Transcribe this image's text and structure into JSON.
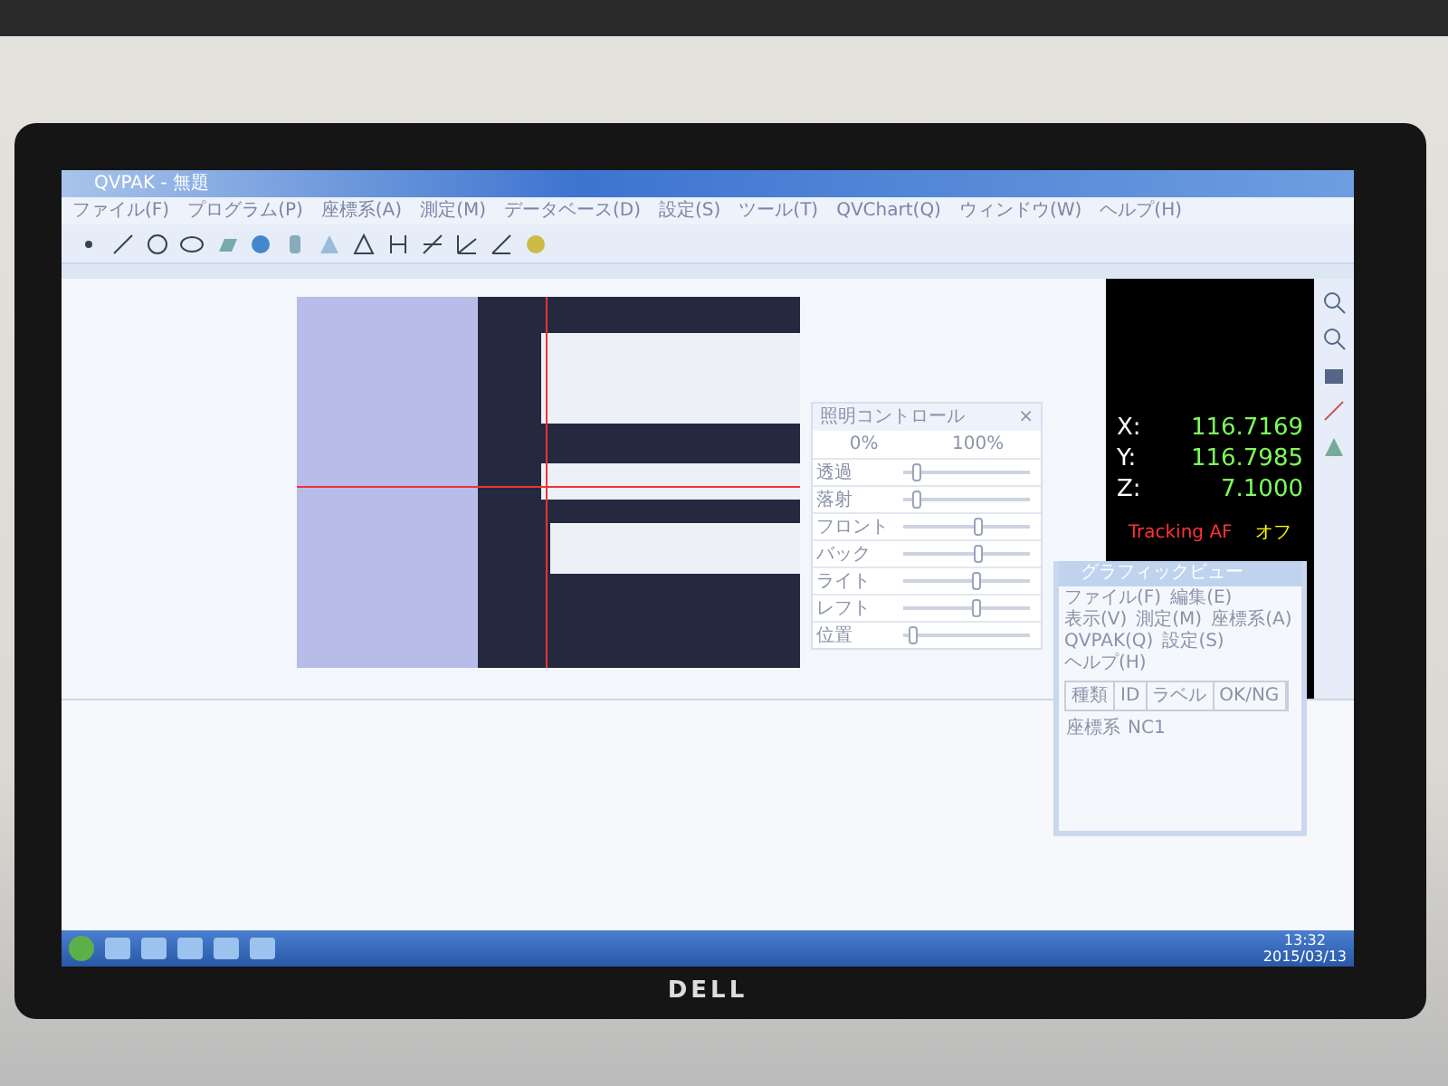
{
  "brand": "DELL",
  "window": {
    "title": "QVPAK - 無題"
  },
  "menu": [
    "ファイル(F)",
    "プログラム(P)",
    "座標系(A)",
    "測定(M)",
    "データベース(D)",
    "設定(S)",
    "ツール(T)",
    "QVChart(Q)",
    "ウィンドウ(W)",
    "ヘルプ(H)"
  ],
  "lighting_panel": {
    "title": "照明コントロール",
    "close": "×",
    "scale_min": "0%",
    "scale_max": "100%",
    "rows": [
      {
        "label": "透過",
        "level": 0.08
      },
      {
        "label": "落射",
        "level": 0.08
      },
      {
        "label": "フロント",
        "level": 0.62
      },
      {
        "label": "バック",
        "level": 0.62
      },
      {
        "label": "ライト",
        "level": 0.6
      },
      {
        "label": "レフト",
        "level": 0.6
      },
      {
        "label": "位置",
        "level": 0.04
      }
    ]
  },
  "dro": {
    "axes": [
      {
        "label": "X:",
        "value": "116.7169"
      },
      {
        "label": "Y:",
        "value": "116.7985"
      },
      {
        "label": "Z:",
        "value": "7.1000"
      }
    ],
    "tracking_label": "Tracking AF",
    "tracking_value": "オフ"
  },
  "graphic_window": {
    "title": "グラフィックビュー",
    "menu": [
      "ファイル(F)",
      "編集(E)",
      "表示(V)",
      "測定(M)",
      "座標系(A)",
      "QVPAK(Q)",
      "設定(S)",
      "ヘルプ(H)"
    ],
    "columns": [
      "種類",
      "ID",
      "ラベル",
      "OK/NG"
    ],
    "rows": [
      {
        "cells": [
          "座標系",
          "NC1"
        ]
      }
    ]
  },
  "taskbar": {
    "time": "13:32",
    "date": "2015/03/13"
  }
}
